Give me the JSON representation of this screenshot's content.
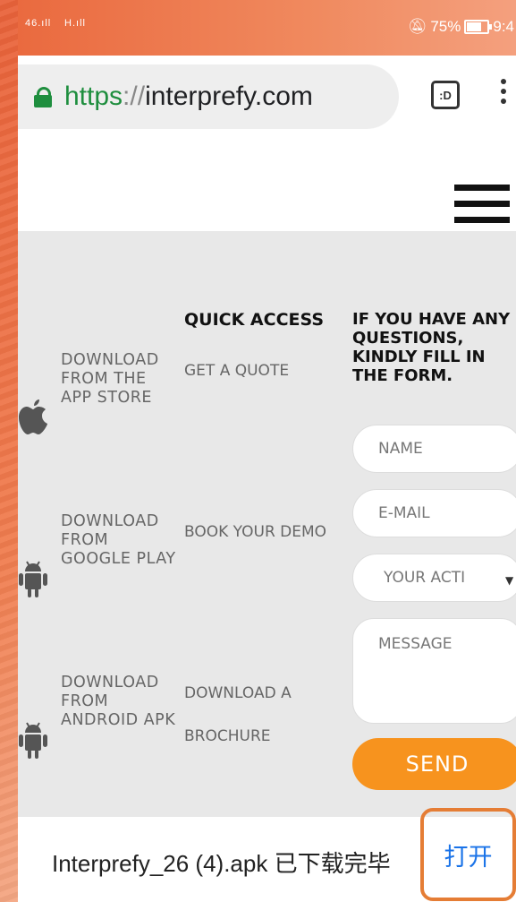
{
  "status_bar": {
    "signal_1": "46",
    "signal_2": "H",
    "battery_percent": "75%",
    "time": "9:4"
  },
  "browser": {
    "url_scheme": "https",
    "url_sep": "://",
    "url_host": "interprefy.com",
    "tabs_label": ":D"
  },
  "footer": {
    "quick_access_title": "QUICK ACCESS",
    "form_title": "IF YOU HAVE ANY QUESTIONS, KINDLY FILL IN THE FORM.",
    "downloads": [
      {
        "label": "DOWNLOAD FROM THE APP STORE",
        "icon": "apple-icon"
      },
      {
        "label": "DOWNLOAD FROM GOOGLE PLAY",
        "icon": "android-icon"
      },
      {
        "label": "DOWNLOAD FROM ANDROID APK",
        "icon": "android-icon"
      }
    ],
    "quick_links": [
      "GET A QUOTE",
      "BOOK YOUR DEMO",
      "DOWNLOAD A",
      "BROCHURE"
    ],
    "form": {
      "name_placeholder": "NAME",
      "email_placeholder": "E-MAIL",
      "activity_selected": "YOUR ACTI",
      "message_placeholder": "MESSAGE",
      "send_label": "SEND",
      "accent_color": "#f7931e"
    }
  },
  "download_bar": {
    "message": "Interprefy_26 (4).apk 已下载完毕",
    "open_label": "打开"
  }
}
